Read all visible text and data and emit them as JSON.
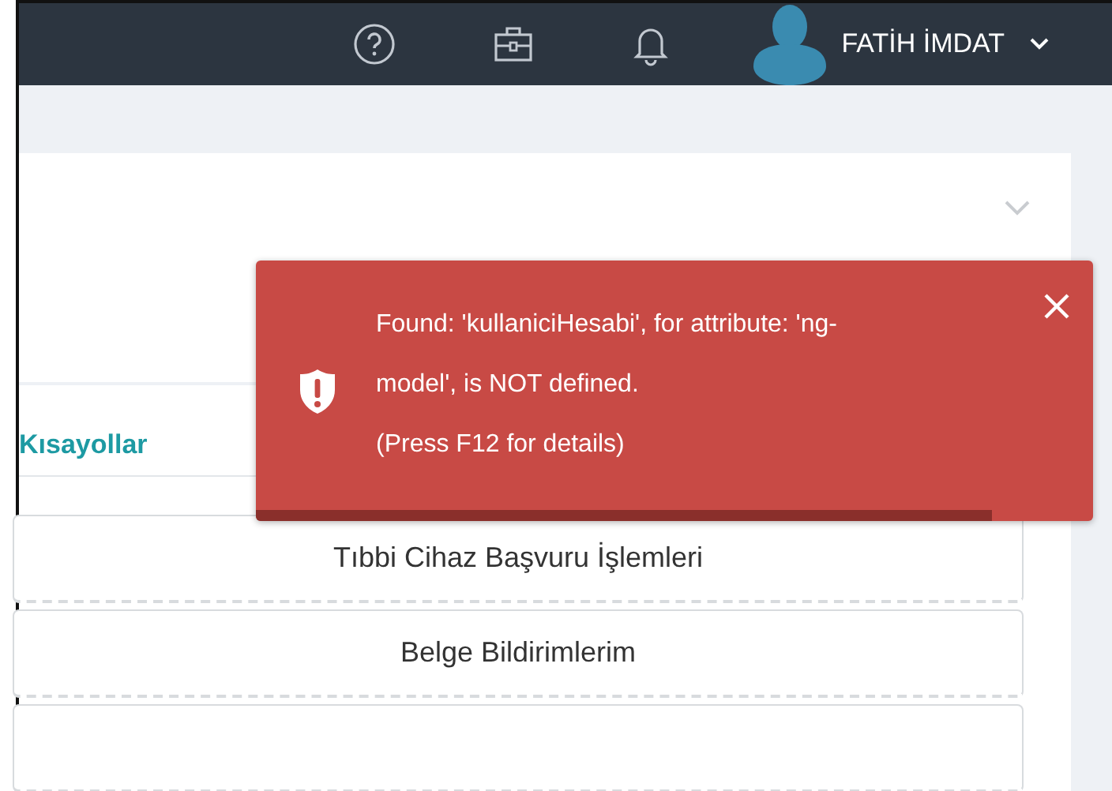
{
  "top_bar": {
    "user_name": "FATİH İMDAT"
  },
  "shortcuts": {
    "title": "Kısayollar",
    "items": [
      {
        "label": "Tıbbi Cihaz Başvuru İşlemleri"
      },
      {
        "label": "Belge Bildirimlerim"
      }
    ]
  },
  "toast": {
    "kind": "error",
    "lines": [
      "Found: 'kullaniciHesabi', for attribute: 'ng-",
      "model', is NOT defined.",
      "(Press F12 for details)"
    ],
    "level": 0.88
  }
}
